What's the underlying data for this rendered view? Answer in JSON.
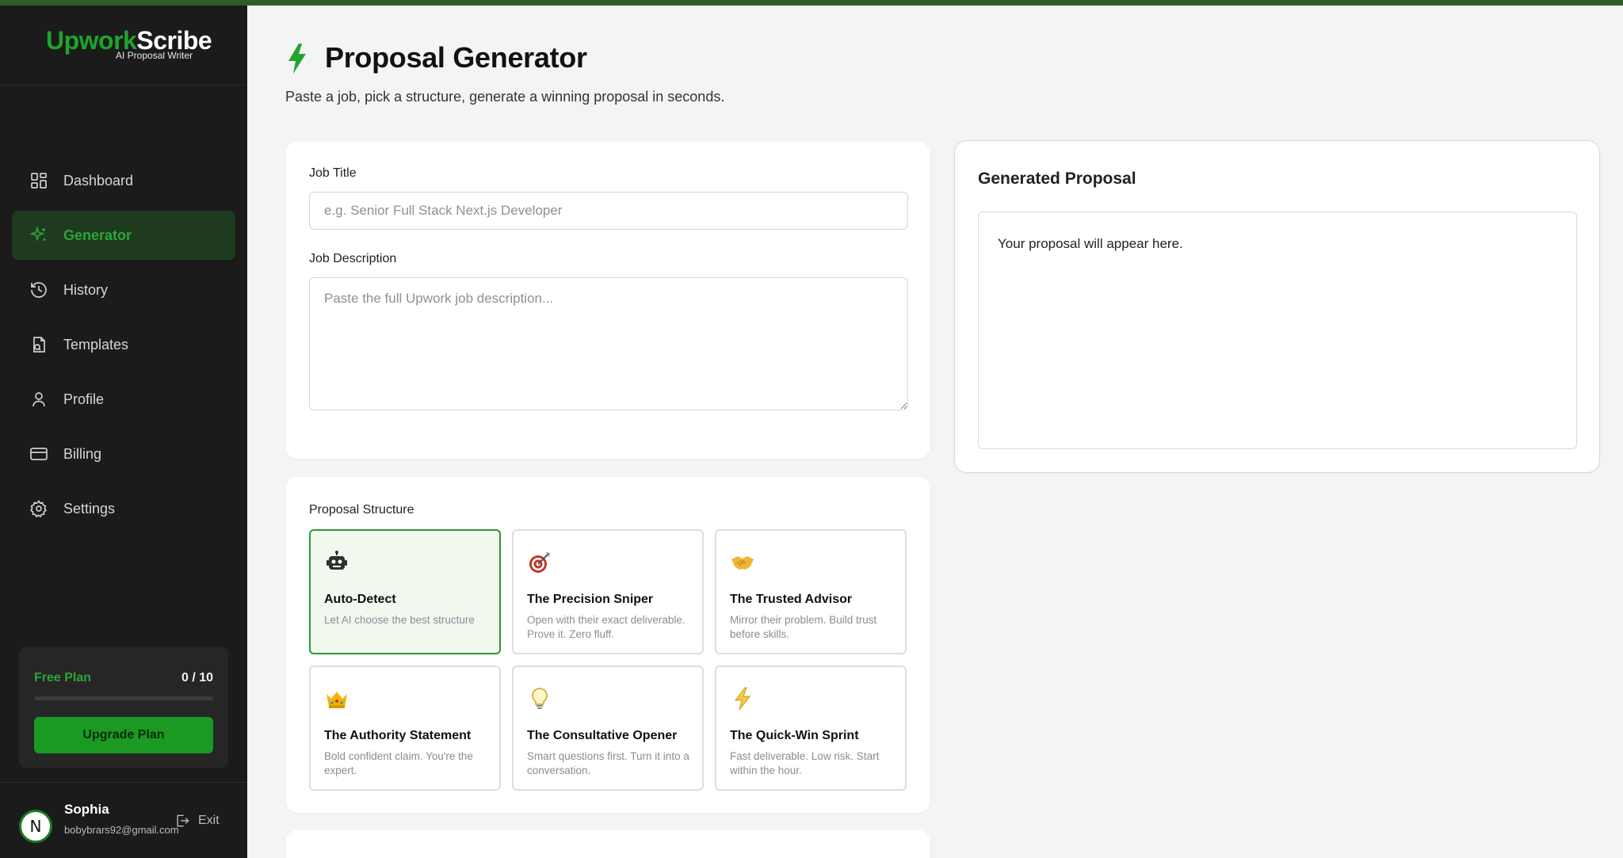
{
  "brand": {
    "name_part1": "Upwork",
    "name_part2": "Scribe",
    "tagline": "AI Proposal Writer"
  },
  "nav": [
    {
      "label": "Dashboard",
      "icon": "grid-icon",
      "active": false
    },
    {
      "label": "Generator",
      "icon": "sparkles-icon",
      "active": true
    },
    {
      "label": "History",
      "icon": "history-icon",
      "active": false
    },
    {
      "label": "Templates",
      "icon": "templates-icon",
      "active": false
    },
    {
      "label": "Profile",
      "icon": "user-icon",
      "active": false
    },
    {
      "label": "Billing",
      "icon": "credit-card-icon",
      "active": false
    },
    {
      "label": "Settings",
      "icon": "gear-icon",
      "active": false
    }
  ],
  "plan": {
    "label": "Free Plan",
    "count": "0 / 10",
    "used_fraction": 0,
    "upgrade_label": "Upgrade Plan"
  },
  "user": {
    "initial": "N",
    "name": "Sophia",
    "email": "bobybrars92@gmail.com",
    "exit_label": "Exit"
  },
  "header": {
    "title": "Proposal Generator",
    "subtitle": "Paste a job, pick a structure, generate a winning proposal in seconds."
  },
  "form": {
    "job_title_label": "Job Title",
    "job_title_placeholder": "e.g. Senior Full Stack Next.js Developer",
    "job_desc_label": "Job Description",
    "job_desc_placeholder": "Paste the full Upwork job description..."
  },
  "structure": {
    "label": "Proposal Structure",
    "options": [
      {
        "icon": "robot-icon",
        "title": "Auto-Detect",
        "desc": "Let AI choose the best structure",
        "selected": true
      },
      {
        "icon": "target-icon",
        "title": "The Precision Sniper",
        "desc": "Open with their exact deliverable. Prove it. Zero fluff.",
        "selected": false
      },
      {
        "icon": "handshake-icon",
        "title": "The Trusted Advisor",
        "desc": "Mirror their problem. Build trust before skills.",
        "selected": false
      },
      {
        "icon": "crown-icon",
        "title": "The Authority Statement",
        "desc": "Bold confident claim. You're the expert.",
        "selected": false
      },
      {
        "icon": "lightbulb-icon",
        "title": "The Consultative Opener",
        "desc": "Smart questions first. Turn it into a conversation.",
        "selected": false
      },
      {
        "icon": "lightning-icon",
        "title": "The Quick-Win Sprint",
        "desc": "Fast deliverable. Low risk. Start within the hour.",
        "selected": false
      }
    ]
  },
  "proposal": {
    "title": "Generated Proposal",
    "placeholder_text": "Your proposal will appear here."
  },
  "colors": {
    "brand_green": "#1fa32c",
    "sidebar_bg": "#1b1b1b",
    "active_bg": "#1f3b1f",
    "selected_border": "#2b9a35"
  }
}
